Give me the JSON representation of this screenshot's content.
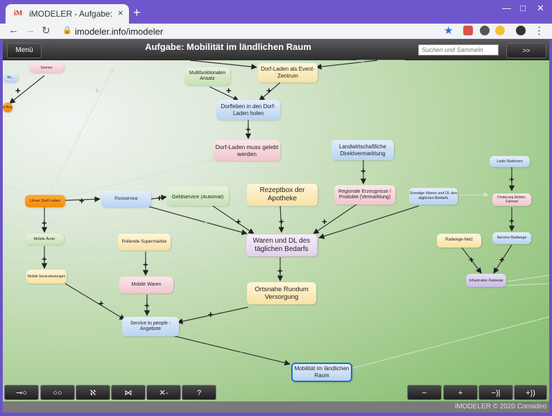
{
  "browser": {
    "tab_title": "iMODELER - Aufgabe: Mobilität im ländlichen Raum",
    "favicon": "iM",
    "url": "imodeler.info/imodeler",
    "new_tab": "+",
    "close_tab": "×"
  },
  "app": {
    "menu_label": "Menü",
    "title": "Aufgabe: Mobilität im ländlichen Raum",
    "search_placeholder": "Suchen und Sammeln",
    "go_label": ">>",
    "copyright": "iMODELER © 2020 Consideo"
  },
  "nodes": {
    "szenen": "Szenen",
    "bus": "e Bus",
    "multifunktionalen": "Multifunktionalen Ansatz",
    "dorfladen_event": "Dorf-Laden als Event-Zentrum",
    "dorfleben": "Dorfleben in den Dorf-Laden holen",
    "dorfladen_gelebt": "Dorf-Laden muss gelebt werden",
    "landwirtschaft": "Landwirtschaftliche Direktvermarktung",
    "ladestation": "Lade-Stationen",
    "unser_dorfladen": "Unser Dorf-Laden",
    "postservice": "Postservice",
    "geldservice": "Geldservice (Automat)",
    "rezeptbox": "Rezeptbox der Apotheke",
    "regionale": "Regionale Erzeugnisse / Produkte (Vermarktung)",
    "sonstige": "Sonstige Waren und DL des täglichen Bedarfs",
    "foerderung": "Förderung Elektro-Fahrrad",
    "mobile_aerzte": "Mobile Ärzte",
    "rollende": "Rollende Supermärkte",
    "waren_dl": "Waren und DL des täglichen Bedarfs",
    "radwege_netz": "Radwege-Netz",
    "service_radwege": "Service Radwege",
    "mobile_service": "Mobile Servicelestungen",
    "mobile_waren": "Mobile Waren",
    "infrastruktur": "Infrastruktur Radwege",
    "ortsnahe": "Ortsnahe Rundum Versorgung",
    "service_people": "Service to people - Angebote",
    "mobilitaet": "Mobilität im ländlichen Raum"
  },
  "plus_sign": "+",
  "bottom": {
    "btn1": "⊸○",
    "btn2": "○○",
    "btn3": "ℵ",
    "btn4": "⋈",
    "btn5": "✕-",
    "btn6": "?",
    "zoom_out": "−",
    "zoom_in": "+",
    "step_back": "−)|",
    "step_fwd": "+))"
  },
  "colors": {
    "browser_frame": "#6f56cc",
    "focus_border": "#1a6fd1"
  }
}
